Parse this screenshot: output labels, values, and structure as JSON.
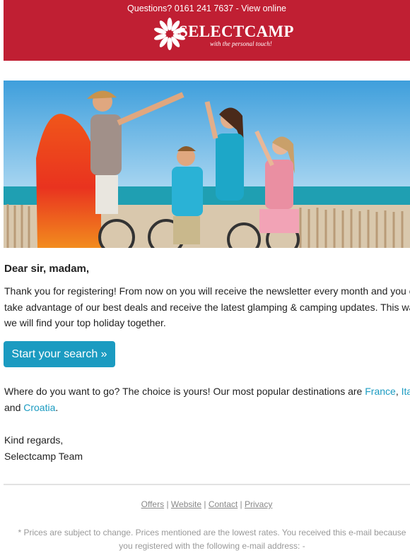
{
  "header": {
    "questions_text": "Questions? 0161 241 7637 - ",
    "view_online_label": "View online",
    "logo_text": "SELECTCAMP",
    "logo_tagline": "with the personal touch!"
  },
  "body": {
    "greeting": "Dear sir, madam,",
    "intro": "Thank you for registering! From now on you will receive the newsletter every month and you can take advantage of our best deals and receive the latest glamping & camping updates. This way we will find your top holiday together.",
    "cta_label": "Start your search »",
    "destinations_prefix": "Where do you want to go? The choice is yours! Our most popular destinations are ",
    "destination_1": "France",
    "separator": ", ",
    "destination_2": "Italy",
    "and": " and ",
    "destination_3": "Croatia",
    "period": ".",
    "regards": "Kind regards,",
    "signature": "Selectcamp Team"
  },
  "footer": {
    "links": [
      "Offers",
      "Website",
      "Contact",
      "Privacy"
    ],
    "sep": " | ",
    "disclaimer": "* Prices are subject to change. Prices mentioned are the lowest rates. You received this e-mail because you registered with the following e-mail address: -"
  },
  "colors": {
    "header_bg": "#c01f33",
    "cta_bg": "#1b9bc1",
    "link": "#1b9bc1"
  }
}
